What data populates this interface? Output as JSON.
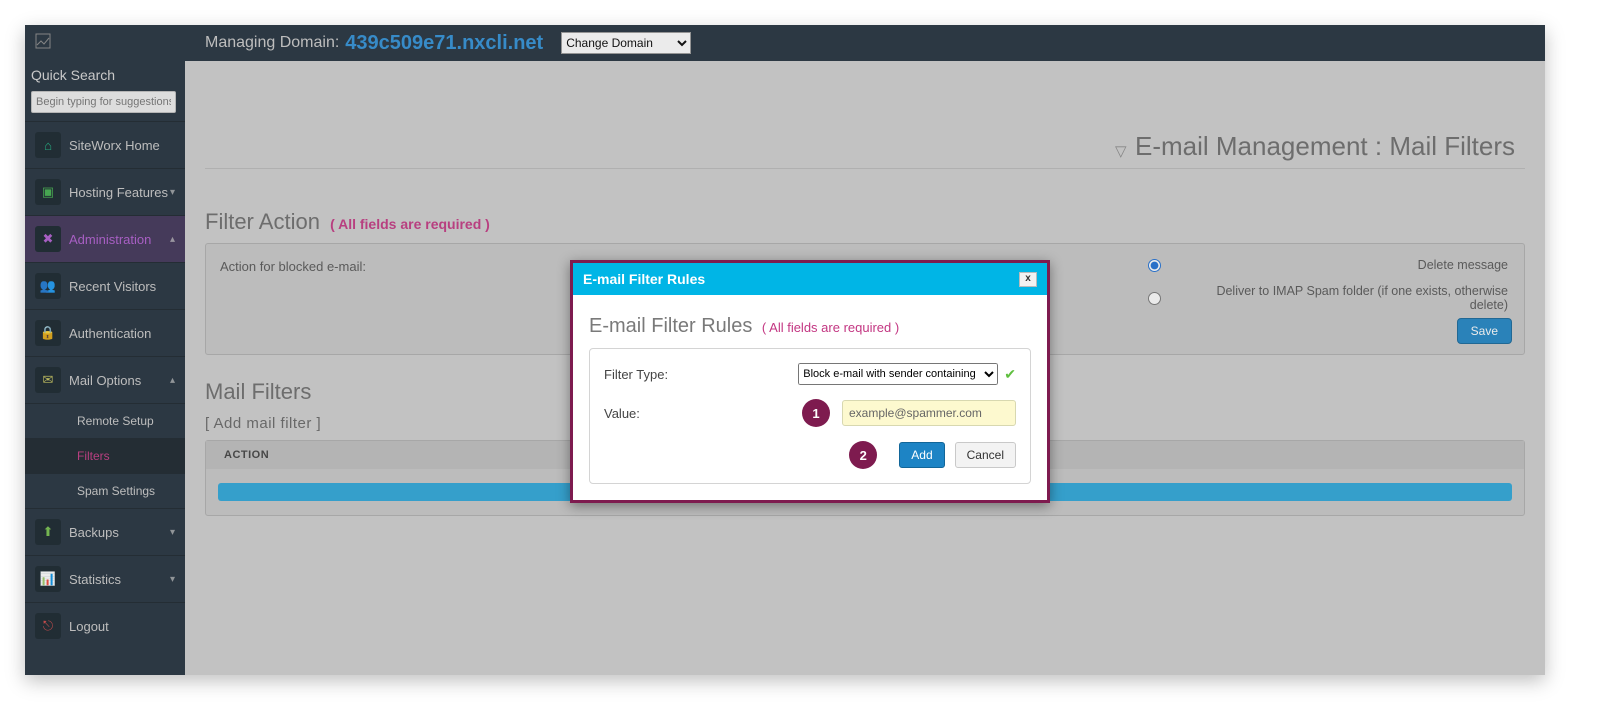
{
  "topbar": {
    "managing_label": "Managing Domain:",
    "domain": "439c509e71.nxcli.net",
    "change_domain_selected": "Change Domain"
  },
  "sidebar": {
    "quick_search_label": "Quick Search",
    "quick_search_placeholder": "Begin typing for suggestions",
    "items": [
      {
        "id": "siteworx-home",
        "label": "SiteWorx Home"
      },
      {
        "id": "hosting-features",
        "label": "Hosting Features"
      },
      {
        "id": "administration",
        "label": "Administration"
      },
      {
        "id": "recent-visitors",
        "label": "Recent Visitors"
      },
      {
        "id": "authentication",
        "label": "Authentication"
      },
      {
        "id": "mail-options",
        "label": "Mail Options"
      },
      {
        "id": "remote-setup",
        "label": "Remote Setup"
      },
      {
        "id": "filters",
        "label": "Filters"
      },
      {
        "id": "spam-settings",
        "label": "Spam Settings"
      },
      {
        "id": "backups",
        "label": "Backups"
      },
      {
        "id": "statistics",
        "label": "Statistics"
      },
      {
        "id": "logout",
        "label": "Logout"
      }
    ]
  },
  "page": {
    "title": "E-mail Management : Mail Filters"
  },
  "filter_action": {
    "section_label": "Filter Action",
    "required_text": "( All fields are required )",
    "action_label": "Action for blocked e-mail:",
    "radio_delete": "Delete message",
    "radio_imap": "Deliver to IMAP Spam folder (if one exists, otherwise delete)",
    "save_label": "Save"
  },
  "mail_filters": {
    "section_label": "Mail Filters",
    "add_link": "[ Add mail filter ]",
    "table_header_action": "ACTION"
  },
  "modal": {
    "title": "E-mail Filter Rules",
    "close_glyph": "x",
    "subhead": "E-mail Filter Rules",
    "required_text": "( All fields are required )",
    "filter_type_label": "Filter Type:",
    "filter_type_selected": "Block e-mail with sender containing",
    "value_label": "Value:",
    "value_input": "example@spammer.com",
    "callout_1": "1",
    "callout_2": "2",
    "add_label": "Add",
    "cancel_label": "Cancel"
  }
}
